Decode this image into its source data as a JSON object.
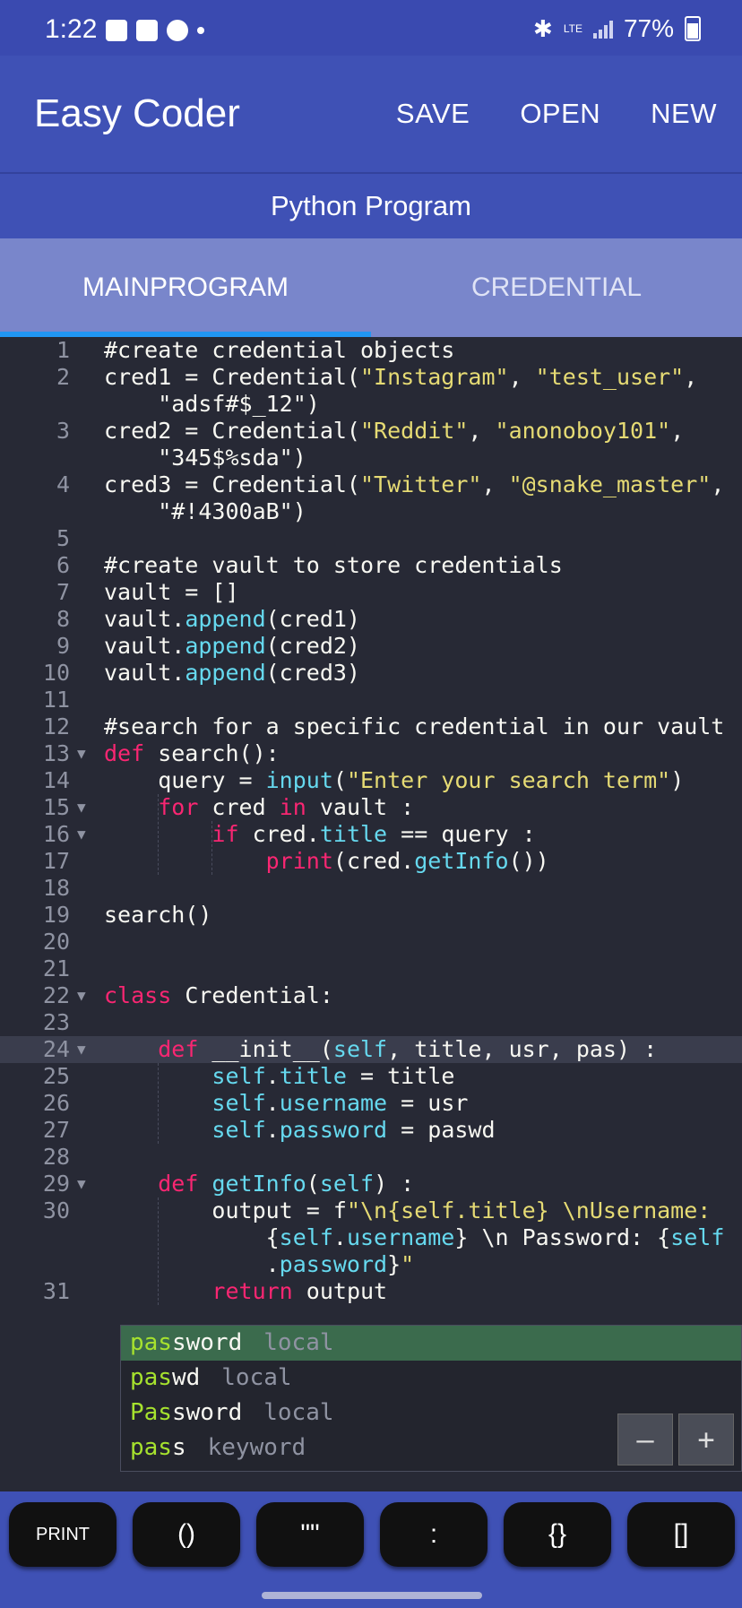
{
  "status": {
    "time": "1:22",
    "network": "LTE",
    "battery": "77%"
  },
  "app": {
    "title": "Easy Coder",
    "actions": {
      "save": "SAVE",
      "open": "OPEN",
      "new": "NEW"
    }
  },
  "subtitle": "Python Program",
  "tabs": {
    "main": "MAINPROGRAM",
    "credential": "CREDENTIAL"
  },
  "code": {
    "lines": [
      {
        "num": "1",
        "text": "#create credential objects"
      },
      {
        "num": "2",
        "text": "cred1 = Credential(\"Instagram\", \"test_user\","
      },
      {
        "num": "",
        "text": "    \"adsf#$_12\")"
      },
      {
        "num": "3",
        "text": "cred2 = Credential(\"Reddit\", \"anonoboy101\","
      },
      {
        "num": "",
        "text": "    \"345$%sda\")"
      },
      {
        "num": "4",
        "text": "cred3 = Credential(\"Twitter\", \"@snake_master\","
      },
      {
        "num": "",
        "text": "    \"#!4300aB\")"
      },
      {
        "num": "5",
        "text": ""
      },
      {
        "num": "6",
        "text": "#create vault to store credentials"
      },
      {
        "num": "7",
        "text": "vault = []"
      },
      {
        "num": "8",
        "text": "vault.append(cred1)"
      },
      {
        "num": "9",
        "text": "vault.append(cred2)"
      },
      {
        "num": "10",
        "text": "vault.append(cred3)"
      },
      {
        "num": "11",
        "text": ""
      },
      {
        "num": "12",
        "text": "#search for a specific credential in our vault"
      },
      {
        "num": "13",
        "text": "def search():"
      },
      {
        "num": "14",
        "text": "    query = input(\"Enter your search term\")"
      },
      {
        "num": "15",
        "text": "    for cred in vault :"
      },
      {
        "num": "16",
        "text": "        if cred.title == query :"
      },
      {
        "num": "17",
        "text": "            print(cred.getInfo())"
      },
      {
        "num": "18",
        "text": ""
      },
      {
        "num": "19",
        "text": "search()"
      },
      {
        "num": "20",
        "text": ""
      },
      {
        "num": "21",
        "text": ""
      },
      {
        "num": "22",
        "text": "class Credential:"
      },
      {
        "num": "23",
        "text": ""
      },
      {
        "num": "24",
        "text": "    def __init__(self, title, usr, pas) :"
      },
      {
        "num": "25",
        "text": "        self.title = title"
      },
      {
        "num": "26",
        "text": "        self.username = usr"
      },
      {
        "num": "27",
        "text": "        self.password = paswd"
      },
      {
        "num": "28",
        "text": ""
      },
      {
        "num": "29",
        "text": "    def getInfo(self) :"
      },
      {
        "num": "30",
        "text": "        output = f\"\\n{self.title} \\nUsername:"
      },
      {
        "num": "",
        "text": "            {self.username} \\n Password: {self"
      },
      {
        "num": "",
        "text": "            .password}\""
      },
      {
        "num": "31",
        "text": "        return output"
      }
    ]
  },
  "autocomplete": {
    "items": [
      {
        "match": "pas",
        "rest": "sword",
        "type": "local"
      },
      {
        "match": "pas",
        "rest": "wd",
        "type": "local"
      },
      {
        "match": "Pas",
        "rest": "sword",
        "type": "local"
      },
      {
        "match": "pas",
        "rest": "s",
        "type": "keyword"
      }
    ],
    "zoom_out": "—",
    "zoom_in": "+"
  },
  "keys": [
    "PRINT",
    "()",
    "\"\"",
    ":",
    "{}",
    "[]"
  ],
  "colors": {
    "appbar": "#3f51b5",
    "tabs": "#7986cb",
    "editor_bg": "#272935",
    "indicator": "#2196f3"
  }
}
